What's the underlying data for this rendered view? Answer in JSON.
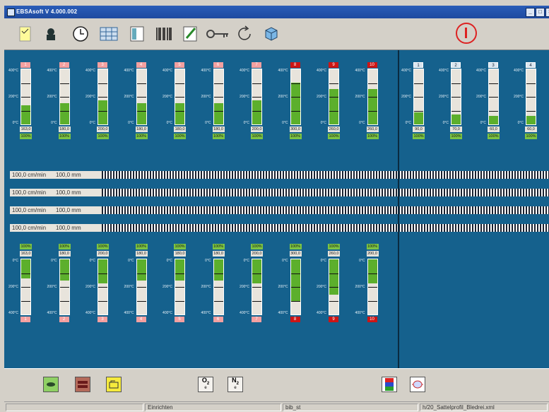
{
  "window": {
    "title": "EBSAsoft V 4.000.002"
  },
  "toolbar": {
    "icons": [
      "notes-icon",
      "profile-icon",
      "clock-icon",
      "table-icon",
      "catalog-icon",
      "barcode-icon",
      "edit-icon",
      "key-icon",
      "refresh-icon",
      "cube-icon"
    ],
    "stop_icon": "power-stop-icon"
  },
  "upper_tanks": [
    {
      "num": "1",
      "value": "163,0",
      "pct": "100%",
      "fill": 0.34,
      "hot": false
    },
    {
      "num": "2",
      "value": "180,0",
      "pct": "100%",
      "fill": 0.38,
      "hot": false
    },
    {
      "num": "3",
      "value": "200,0",
      "pct": "100%",
      "fill": 0.44,
      "hot": false
    },
    {
      "num": "4",
      "value": "180,0",
      "pct": "100%",
      "fill": 0.38,
      "hot": false
    },
    {
      "num": "5",
      "value": "180,0",
      "pct": "100%",
      "fill": 0.38,
      "hot": false
    },
    {
      "num": "6",
      "value": "180,0",
      "pct": "100%",
      "fill": 0.38,
      "hot": false
    },
    {
      "num": "7",
      "value": "200,0",
      "pct": "100%",
      "fill": 0.44,
      "hot": false
    },
    {
      "num": "8",
      "value": "300,0",
      "pct": "100%",
      "fill": 0.75,
      "hot": true
    },
    {
      "num": "9",
      "value": "260,0",
      "pct": "100%",
      "fill": 0.64,
      "hot": true
    },
    {
      "num": "10",
      "value": "260,0",
      "pct": "100%",
      "fill": 0.64,
      "hot": true
    }
  ],
  "right_tanks": [
    {
      "num": "1",
      "value": "90,0",
      "pct": "100%",
      "fill": 0.22
    },
    {
      "num": "2",
      "value": "70,0",
      "pct": "100%",
      "fill": 0.18
    },
    {
      "num": "3",
      "value": "60,0",
      "pct": "100%",
      "fill": 0.15
    },
    {
      "num": "4",
      "value": "60,0",
      "pct": "100%",
      "fill": 0.15
    }
  ],
  "axis_labels": {
    "top": "400°C",
    "mid": "200°C",
    "bottom": "0°C"
  },
  "feed_lines": [
    {
      "speed": "100,0 cm/min",
      "length": "100,0 mm"
    },
    {
      "speed": "100,0 cm/min",
      "length": "100,0 mm"
    },
    {
      "speed": "100,0 cm/min",
      "length": "100,0 mm"
    },
    {
      "speed": "100,0 cm/min",
      "length": "100,0 mm"
    }
  ],
  "lower_tanks": [
    {
      "num": "1",
      "value": "163,0",
      "pct": "100%",
      "fill": 0.34,
      "hot": false
    },
    {
      "num": "2",
      "value": "180,0",
      "pct": "100%",
      "fill": 0.38,
      "hot": false
    },
    {
      "num": "3",
      "value": "200,0",
      "pct": "100%",
      "fill": 0.44,
      "hot": false
    },
    {
      "num": "4",
      "value": "180,0",
      "pct": "100%",
      "fill": 0.38,
      "hot": false
    },
    {
      "num": "5",
      "value": "180,0",
      "pct": "100%",
      "fill": 0.38,
      "hot": false
    },
    {
      "num": "6",
      "value": "180,0",
      "pct": "100%",
      "fill": 0.38,
      "hot": false
    },
    {
      "num": "7",
      "value": "200,0",
      "pct": "100%",
      "fill": 0.44,
      "hot": false
    },
    {
      "num": "8",
      "value": "300,0",
      "pct": "100%",
      "fill": 0.75,
      "hot": true
    },
    {
      "num": "9",
      "value": "260,0",
      "pct": "100%",
      "fill": 0.64,
      "hot": true
    },
    {
      "num": "10",
      "value": "200,0",
      "pct": "100%",
      "fill": 0.44,
      "hot": true
    }
  ],
  "bottom_toolbar": {
    "o2_label": "O",
    "o2_sub": "2",
    "o2_unit": "e",
    "n2_label": "N",
    "n2_sub": "2",
    "n2_unit": "e"
  },
  "statusbar": {
    "mode": "Einrichten",
    "user": "bib_st",
    "file": "h/20_Sattelprofil_Bledrei.xml"
  },
  "colors": {
    "panel_blue": "#15618d",
    "fill_green": "#5caf2c",
    "hot_red": "#cc1515",
    "warm_pink": "#f4a0a0"
  }
}
